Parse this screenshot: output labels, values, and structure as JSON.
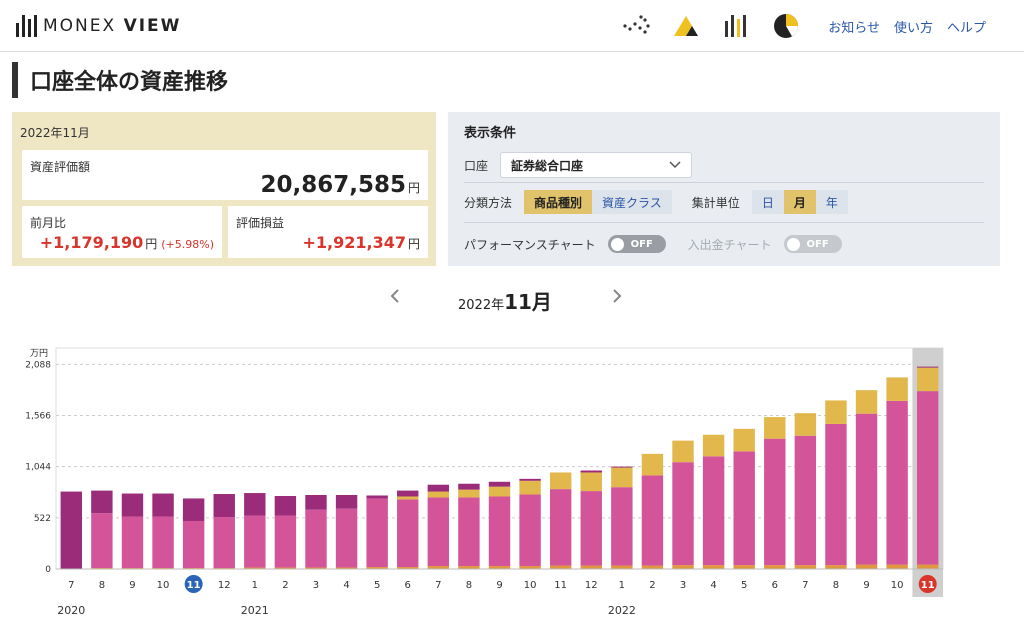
{
  "header": {
    "logo_text_light": "MONEX ",
    "logo_text_bold": "VIEW",
    "icons": [
      "dots-icon",
      "peak-icon",
      "bars-icon",
      "pie-icon"
    ],
    "links": [
      "お知らせ",
      "使い方",
      "ヘルプ"
    ]
  },
  "page": {
    "title": "口座全体の資産推移"
  },
  "summary": {
    "date": "2022年11月",
    "asset_label": "資産評価額",
    "asset_value": "20,867,585",
    "yen": "円",
    "mom_label": "前月比",
    "mom_value": "+1,179,190",
    "mom_pct": "(+5.98%)",
    "pl_label": "評価損益",
    "pl_value": "+1,921,347"
  },
  "conditions": {
    "title": "表示条件",
    "account_label": "口座",
    "account_value": "証券総合口座",
    "classify_label": "分類方法",
    "classify_options": [
      "商品種別",
      "資産クラス"
    ],
    "classify_selected": 0,
    "unit_label": "集計単位",
    "unit_options": [
      "日",
      "月",
      "年"
    ],
    "unit_selected": 1,
    "performance_label": "パフォーマンスチャート",
    "performance_toggle": "OFF",
    "deposit_label": "入出金チャート",
    "deposit_toggle": "OFF"
  },
  "month_nav": {
    "year": "2022年",
    "month": "11月"
  },
  "colors": {
    "series_a": "#9b2c7a",
    "series_b": "#d4549a",
    "series_c": "#e2b84c",
    "series_d": "#e09840",
    "accent_blue": "#2a56a8",
    "accent_red": "#d9352b"
  },
  "chart_data": {
    "type": "bar",
    "stacked": true,
    "unit_label": "万円",
    "yticks": [
      "2,088",
      "1,566",
      "1,044",
      "522",
      "0"
    ],
    "ylim": [
      0,
      2088
    ],
    "grid": true,
    "categories": [
      "7",
      "8",
      "9",
      "10",
      "11",
      "12",
      "1",
      "2",
      "3",
      "4",
      "5",
      "6",
      "7",
      "8",
      "9",
      "10",
      "11",
      "12",
      "1",
      "2",
      "3",
      "4",
      "5",
      "6",
      "7",
      "8",
      "9",
      "10",
      "11"
    ],
    "year_labels": [
      {
        "index": 0,
        "label": "2020"
      },
      {
        "index": 6,
        "label": "2021"
      },
      {
        "index": 18,
        "label": "2022"
      }
    ],
    "highlighted_index": 28,
    "circled_indices": [
      {
        "index": 4,
        "color": "#2a64b8"
      },
      {
        "index": 28,
        "color": "#d9352b"
      }
    ],
    "series": [
      {
        "values": [
          790,
          230,
          235,
          235,
          230,
          235,
          230,
          200,
          150,
          140,
          30,
          60,
          70,
          60,
          50,
          20,
          0,
          20,
          10,
          0,
          0,
          0,
          0,
          0,
          0,
          0,
          0,
          0,
          10
        ]
      },
      {
        "values": [
          0,
          560,
          525,
          525,
          480,
          520,
          530,
          530,
          590,
          600,
          700,
          690,
          700,
          700,
          710,
          730,
          780,
          760,
          800,
          920,
          1050,
          1110,
          1160,
          1290,
          1320,
          1440,
          1540,
          1670,
          1770
        ]
      },
      {
        "values": [
          0,
          0,
          0,
          0,
          0,
          0,
          0,
          0,
          0,
          0,
          0,
          30,
          60,
          80,
          100,
          140,
          170,
          190,
          200,
          220,
          220,
          220,
          230,
          220,
          230,
          240,
          240,
          240,
          240
        ]
      },
      {
        "values": [
          0,
          10,
          10,
          10,
          10,
          10,
          15,
          15,
          15,
          15,
          20,
          20,
          30,
          30,
          30,
          30,
          35,
          35,
          35,
          35,
          40,
          40,
          40,
          40,
          40,
          40,
          45,
          45,
          45
        ]
      }
    ]
  }
}
